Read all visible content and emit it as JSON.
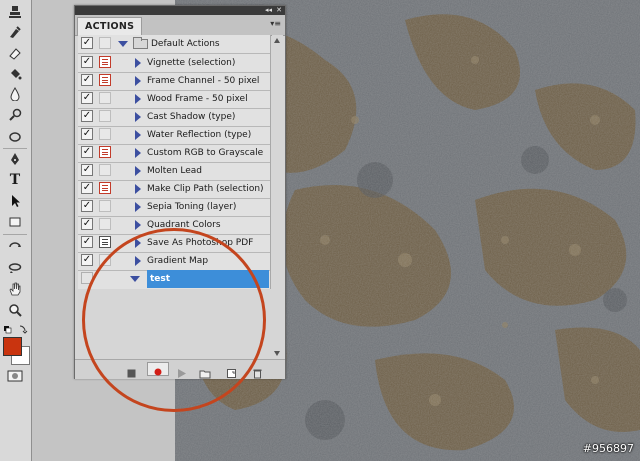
{
  "panel": {
    "tab_label": "ACTIONS",
    "collapse_glyph": "◂◂",
    "close_glyph": "✕",
    "menu_glyph": "▾≡",
    "set": {
      "name": "Default Actions"
    },
    "items": [
      {
        "label": "Vignette (selection)",
        "dialog": "red",
        "checked": true
      },
      {
        "label": "Frame Channel - 50 pixel",
        "dialog": "red",
        "checked": true
      },
      {
        "label": "Wood Frame - 50 pixel",
        "dialog": "none",
        "checked": true
      },
      {
        "label": "Cast Shadow (type)",
        "dialog": "none",
        "checked": true
      },
      {
        "label": "Water Reflection (type)",
        "dialog": "none",
        "checked": true
      },
      {
        "label": "Custom RGB to Grayscale",
        "dialog": "red",
        "checked": true
      },
      {
        "label": "Molten Lead",
        "dialog": "none",
        "checked": true
      },
      {
        "label": "Make Clip Path (selection)",
        "dialog": "red",
        "checked": true
      },
      {
        "label": "Sepia Toning (layer)",
        "dialog": "none",
        "checked": true
      },
      {
        "label": "Quadrant Colors",
        "dialog": "none",
        "checked": true
      },
      {
        "label": "Save As Photoshop PDF",
        "dialog": "dark",
        "checked": true
      },
      {
        "label": "Gradient Map",
        "dialog": "none",
        "checked": true
      }
    ],
    "new_set": {
      "name": "test",
      "checked": false,
      "selected": true
    },
    "bottom_buttons": [
      "stop-button",
      "record-button",
      "play-button",
      "new-set-button",
      "new-action-button",
      "delete-button"
    ]
  },
  "tools": [
    "move-tool",
    "lasso-tool",
    "magic-wand-tool",
    "crop-tool",
    "eyedropper-tool",
    "spot-healing-tool",
    "brush-tool",
    "clone-stamp-tool",
    "history-brush-tool",
    "eraser-tool",
    "paint-bucket-tool",
    "blur-tool",
    "dodge-tool",
    "pen-tool",
    "type-tool",
    "path-selection-tool",
    "rectangle-tool",
    "3d-rotate-tool",
    "3d-orbit-tool",
    "hand-tool",
    "zoom-tool"
  ],
  "colors": {
    "foreground": "#c9340f",
    "background": "#ffffff",
    "highlight": "#c4451e",
    "selection": "#3d8ed9"
  },
  "type_tool_glyph": "T",
  "watermark": "#956897"
}
